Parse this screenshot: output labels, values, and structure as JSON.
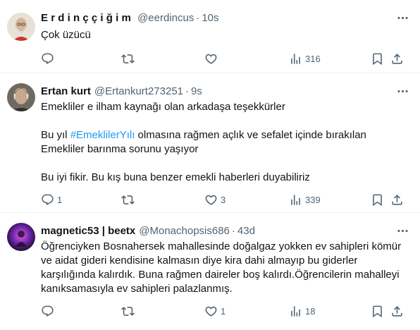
{
  "tweets": [
    {
      "name": "Erdinççiğim",
      "handle": "@eerdincus",
      "time": "10s",
      "paragraphs": [
        "Çok üzücü"
      ],
      "replies": "",
      "retweets": "",
      "likes": "",
      "views": "316"
    },
    {
      "name": "Ertan kurt",
      "handle": "@Ertankurt273251",
      "time": "9s",
      "p1": "Emekliler e ilham kaynağı olan arkadaşa teşekkürler",
      "p2_pre": "Bu yıl ",
      "p2_tag": "#EmeklilerYılı",
      "p2_post": " olmasına rağmen açlık ve sefalet içinde bırakılan Emekliler barınma sorunu yaşıyor",
      "p3": "Bu iyi fikir.  Bu kış buna benzer emekli haberleri duyabiliriz",
      "replies": "1",
      "retweets": "",
      "likes": "3",
      "views": "339"
    },
    {
      "name": "magnetic53 | beetx",
      "handle": "@Monachopsis686",
      "time": "43d",
      "paragraphs": [
        "Öğrenciyken Bosnahersek mahallesinde doğalgaz yokken ev sahipleri kömür ve aidat gideri kendisine kalmasın diye kira dahi almayıp bu giderler karşılığında kalırdık. Buna rağmen daireler boş kalırdı.Öğrencilerin mahalleyi kanıksamasıyla ev sahipleri palazlanmış."
      ],
      "replies": "",
      "retweets": "",
      "likes": "1",
      "views": "18"
    }
  ],
  "separator": "·",
  "icons": {
    "more": "more-horizontal-icon",
    "reply": "reply-icon",
    "retweet": "retweet-icon",
    "like": "heart-icon",
    "views": "views-chart-icon",
    "bookmark": "bookmark-icon",
    "share": "share-icon"
  },
  "colors": {
    "text": "#0f1419",
    "secondary": "#536471",
    "hashtag": "#1d9bf0",
    "divider": "#eff3f4"
  }
}
